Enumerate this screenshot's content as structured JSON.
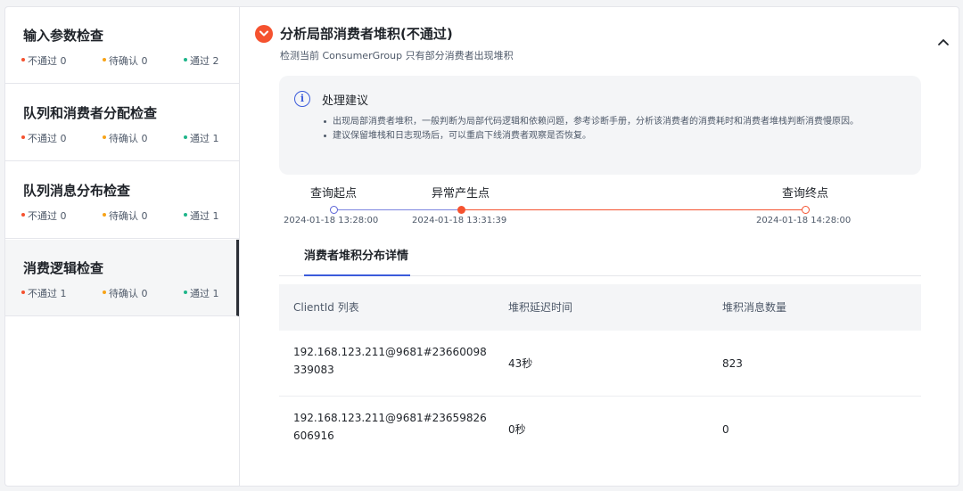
{
  "sidebar": {
    "items": [
      {
        "title": "输入参数检查",
        "fail": "不通过 0",
        "pending": "待确认 0",
        "pass": "通过 2"
      },
      {
        "title": "队列和消费者分配检查",
        "fail": "不通过 0",
        "pending": "待确认 0",
        "pass": "通过 1"
      },
      {
        "title": "队列消息分布检查",
        "fail": "不通过 0",
        "pending": "待确认 0",
        "pass": "通过 1"
      },
      {
        "title": "消费逻辑检查",
        "fail": "不通过 1",
        "pending": "待确认 0",
        "pass": "通过 1"
      }
    ]
  },
  "main": {
    "title": "分析局部消费者堆积(不通过)",
    "subtitle": "检测当前 ConsumerGroup 只有部分消费者出现堆积",
    "advice": {
      "title": "处理建议",
      "items": [
        "出现局部消费者堆积，一般判断为局部代码逻辑和依赖问题，参考诊断手册，分析该消费者的消费耗时和消费者堆栈判断消费慢原因。",
        "建议保留堆栈和日志现场后，可以重启下线消费者观察是否恢复。"
      ]
    },
    "timeline": {
      "start_label": "查询起点",
      "start_time": "2024-01-18 13:28:00",
      "anomaly_label": "异常产生点",
      "anomaly_time": "2024-01-18 13:31:39",
      "end_label": "查询终点",
      "end_time": "2024-01-18 14:28:00"
    },
    "tab": "消费者堆积分布详情",
    "table": {
      "headers": [
        "ClientId 列表",
        "堆积延迟时间",
        "堆积消息数量"
      ],
      "rows": [
        [
          "192.168.123.211@9681#23660098339083",
          "43秒",
          "823"
        ],
        [
          "192.168.123.211@9681#23659826606916",
          "0秒",
          "0"
        ]
      ]
    }
  },
  "colors": {
    "fail": "#f5522f",
    "pending": "#f7a318",
    "pass": "#1fb58a",
    "accent": "#3b5bdb"
  }
}
